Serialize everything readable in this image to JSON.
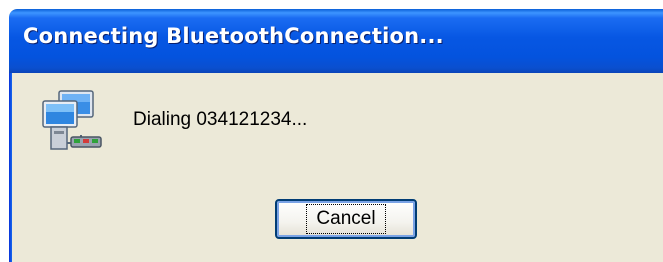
{
  "dialog": {
    "title": "Connecting BluetoothConnection...",
    "status": "Dialing 034121234...",
    "icon": "network-connection-icon",
    "cancel_label": "Cancel"
  },
  "colors": {
    "titlebar": "#0757e3",
    "body": "#ece9d8",
    "button_border": "#003c74"
  }
}
